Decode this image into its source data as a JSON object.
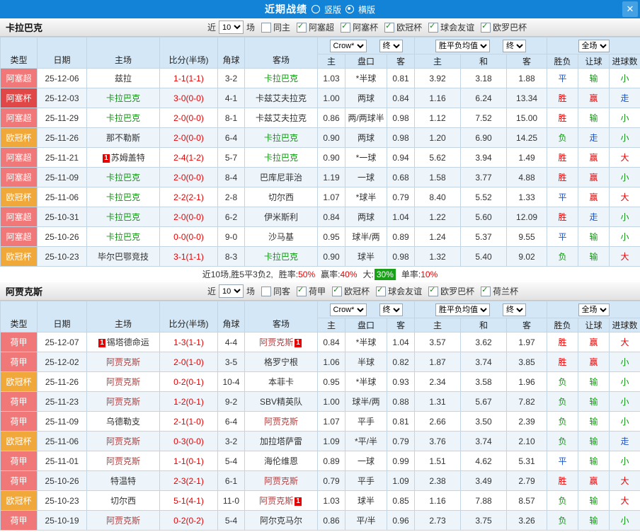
{
  "topbar": {
    "title": "近期战绩",
    "vertical_label": "竖版",
    "horizontal_label": "横版",
    "selected_layout": "横版",
    "close_glyph": "✕",
    "bg": "#1283d6"
  },
  "filter_words": {
    "near": "近",
    "matches": "场"
  },
  "table_head": {
    "fixed_columns": [
      "类型",
      "日期",
      "主场",
      "比分(半场)",
      "角球",
      "客场"
    ],
    "sub_columns": [
      "主",
      "盘口",
      "客",
      "主",
      "和",
      "客",
      "胜负",
      "让球",
      "进球数"
    ],
    "selects": {
      "bookmaker": "Crow*",
      "final": "终",
      "europe_mean": "胜平负均值",
      "scope": "全场"
    }
  },
  "colors": {
    "type_bg": {
      "阿塞超": "#f07878",
      "阿塞杯": "#e04848",
      "欧冠杯": "#f0a83a",
      "荷甲": "#f07878",
      "荷兰杯": "#d8a800"
    },
    "result": {
      "胜": "#e60000",
      "平": "#2053c8",
      "负": "#0c9a0c",
      "赢": "#e60000",
      "走": "#2053c8",
      "输": "#0c9a0c",
      "大": "#e60000",
      "小": "#0c9a0c"
    },
    "score": "#e60000",
    "badge_bg": "#e60000"
  },
  "sections": [
    {
      "team": "卡拉巴克",
      "subject_color": "#0c9a0c",
      "filters": {
        "count": "10",
        "same_label": "同主",
        "same_checked": false,
        "leagues": [
          "阿塞超",
          "阿塞杯",
          "欧冠杯",
          "球会友谊",
          "欧罗巴杯"
        ]
      },
      "rows": [
        {
          "type": "阿塞超",
          "date": "25-12-06",
          "home": "兹拉",
          "score": "1-1(1-1)",
          "corner": "3-2",
          "away": "卡拉巴克",
          "away_subject": true,
          "asia": [
            "1.03",
            "*半球",
            "0.81"
          ],
          "europe": [
            "3.92",
            "3.18",
            "1.88"
          ],
          "results": [
            "平",
            "输",
            "小"
          ]
        },
        {
          "type": "阿塞杯",
          "date": "25-12-03",
          "home": "卡拉巴克",
          "home_subject": true,
          "score": "3-0(0-0)",
          "corner": "4-1",
          "away": "卡兹艾夫拉克",
          "asia": [
            "1.00",
            "两球",
            "0.84"
          ],
          "europe": [
            "1.16",
            "6.24",
            "13.34"
          ],
          "results": [
            "胜",
            "赢",
            "走"
          ]
        },
        {
          "type": "阿塞超",
          "date": "25-11-29",
          "home": "卡拉巴克",
          "home_subject": true,
          "score": "2-0(0-0)",
          "corner": "8-1",
          "away": "卡兹艾夫拉克",
          "asia": [
            "0.86",
            "两/两球半",
            "0.98"
          ],
          "europe": [
            "1.12",
            "7.52",
            "15.00"
          ],
          "results": [
            "胜",
            "输",
            "小"
          ]
        },
        {
          "type": "欧冠杯",
          "date": "25-11-26",
          "home": "那不勒斯",
          "score": "2-0(0-0)",
          "corner": "6-4",
          "away": "卡拉巴克",
          "away_subject": true,
          "asia": [
            "0.90",
            "两球",
            "0.98"
          ],
          "europe": [
            "1.20",
            "6.90",
            "14.25"
          ],
          "results": [
            "负",
            "走",
            "小"
          ]
        },
        {
          "type": "阿塞超",
          "date": "25-11-21",
          "home": "苏姆盖特",
          "home_badge": "1",
          "score": "2-4(1-2)",
          "corner": "5-7",
          "away": "卡拉巴克",
          "away_subject": true,
          "asia": [
            "0.90",
            "*一球",
            "0.94"
          ],
          "europe": [
            "5.62",
            "3.94",
            "1.49"
          ],
          "results": [
            "胜",
            "赢",
            "大"
          ]
        },
        {
          "type": "阿塞超",
          "date": "25-11-09",
          "home": "卡拉巴克",
          "home_subject": true,
          "score": "2-0(0-0)",
          "corner": "8-4",
          "away": "巴库尼菲治",
          "asia": [
            "1.19",
            "一球",
            "0.68"
          ],
          "europe": [
            "1.58",
            "3.77",
            "4.88"
          ],
          "results": [
            "胜",
            "赢",
            "小"
          ]
        },
        {
          "type": "欧冠杯",
          "date": "25-11-06",
          "home": "卡拉巴克",
          "home_subject": true,
          "score": "2-2(2-1)",
          "corner": "2-8",
          "away": "切尔西",
          "asia": [
            "1.07",
            "*球半",
            "0.79"
          ],
          "europe": [
            "8.40",
            "5.52",
            "1.33"
          ],
          "results": [
            "平",
            "赢",
            "大"
          ]
        },
        {
          "type": "阿塞超",
          "date": "25-10-31",
          "home": "卡拉巴克",
          "home_subject": true,
          "score": "2-0(0-0)",
          "corner": "6-2",
          "away": "伊米斯利",
          "asia": [
            "0.84",
            "两球",
            "1.04"
          ],
          "europe": [
            "1.22",
            "5.60",
            "12.09"
          ],
          "results": [
            "胜",
            "走",
            "小"
          ]
        },
        {
          "type": "阿塞超",
          "date": "25-10-26",
          "home": "卡拉巴克",
          "home_subject": true,
          "score": "0-0(0-0)",
          "corner": "9-0",
          "away": "沙马基",
          "asia": [
            "0.95",
            "球半/两",
            "0.89"
          ],
          "europe": [
            "1.24",
            "5.37",
            "9.55"
          ],
          "results": [
            "平",
            "输",
            "小"
          ]
        },
        {
          "type": "欧冠杯",
          "date": "25-10-23",
          "home": "毕尔巴鄂竞技",
          "score": "3-1(1-1)",
          "corner": "8-3",
          "away": "卡拉巴克",
          "away_subject": true,
          "asia": [
            "0.90",
            "球半",
            "0.98"
          ],
          "europe": [
            "1.32",
            "5.40",
            "9.02"
          ],
          "results": [
            "负",
            "输",
            "大"
          ]
        }
      ],
      "summary": {
        "prefix": "近10场,胜5平3负2,",
        "items": [
          {
            "label": "胜率:",
            "value": "50%",
            "style": "red"
          },
          {
            "label": "赢率:",
            "value": "40%",
            "style": "red"
          },
          {
            "label": "大:",
            "value": "30%",
            "style": "green-badge"
          },
          {
            "label": "单率:",
            "value": "10%",
            "style": "red"
          }
        ]
      }
    },
    {
      "team": "阿贾克斯",
      "subject_color": "#b04040",
      "filters": {
        "count": "10",
        "same_label": "同客",
        "same_checked": false,
        "leagues": [
          "荷甲",
          "欧冠杯",
          "球会友谊",
          "欧罗巴杯",
          "荷兰杯"
        ]
      },
      "rows": [
        {
          "type": "荷甲",
          "date": "25-12-07",
          "home": "锡塔德命运",
          "home_badge": "1",
          "score": "1-3(1-1)",
          "corner": "4-4",
          "away": "阿贾克斯",
          "away_subject": true,
          "away_badge": "1",
          "asia": [
            "0.84",
            "*半球",
            "1.04"
          ],
          "europe": [
            "3.57",
            "3.62",
            "1.97"
          ],
          "results": [
            "胜",
            "赢",
            "大"
          ]
        },
        {
          "type": "荷甲",
          "date": "25-12-02",
          "home": "阿贾克斯",
          "home_subject": true,
          "score": "2-0(1-0)",
          "corner": "3-5",
          "away": "格罗宁根",
          "asia": [
            "1.06",
            "半球",
            "0.82"
          ],
          "europe": [
            "1.87",
            "3.74",
            "3.85"
          ],
          "results": [
            "胜",
            "赢",
            "小"
          ]
        },
        {
          "type": "欧冠杯",
          "date": "25-11-26",
          "home": "阿贾克斯",
          "home_subject": true,
          "score": "0-2(0-1)",
          "corner": "10-4",
          "away": "本菲卡",
          "asia": [
            "0.95",
            "*半球",
            "0.93"
          ],
          "europe": [
            "2.34",
            "3.58",
            "1.96"
          ],
          "results": [
            "负",
            "输",
            "小"
          ]
        },
        {
          "type": "荷甲",
          "date": "25-11-23",
          "home": "阿贾克斯",
          "home_subject": true,
          "score": "1-2(0-1)",
          "corner": "9-2",
          "away": "SBV精英队",
          "asia": [
            "1.00",
            "球半/两",
            "0.88"
          ],
          "europe": [
            "1.31",
            "5.67",
            "7.82"
          ],
          "results": [
            "负",
            "输",
            "小"
          ]
        },
        {
          "type": "荷甲",
          "date": "25-11-09",
          "home": "乌德勒支",
          "score": "2-1(1-0)",
          "corner": "6-4",
          "away": "阿贾克斯",
          "away_subject": true,
          "asia": [
            "1.07",
            "平手",
            "0.81"
          ],
          "europe": [
            "2.66",
            "3.50",
            "2.39"
          ],
          "results": [
            "负",
            "输",
            "小"
          ]
        },
        {
          "type": "欧冠杯",
          "date": "25-11-06",
          "home": "阿贾克斯",
          "home_subject": true,
          "score": "0-3(0-0)",
          "corner": "3-2",
          "away": "加拉塔萨雷",
          "asia": [
            "1.09",
            "*平/半",
            "0.79"
          ],
          "europe": [
            "3.76",
            "3.74",
            "2.10"
          ],
          "results": [
            "负",
            "输",
            "走"
          ]
        },
        {
          "type": "荷甲",
          "date": "25-11-01",
          "home": "阿贾克斯",
          "home_subject": true,
          "score": "1-1(0-1)",
          "corner": "5-4",
          "away": "海伦维恩",
          "asia": [
            "0.89",
            "一球",
            "0.99"
          ],
          "europe": [
            "1.51",
            "4.62",
            "5.31"
          ],
          "results": [
            "平",
            "输",
            "小"
          ]
        },
        {
          "type": "荷甲",
          "date": "25-10-26",
          "home": "特温特",
          "score": "2-3(2-1)",
          "corner": "6-1",
          "away": "阿贾克斯",
          "away_subject": true,
          "asia": [
            "0.79",
            "平手",
            "1.09"
          ],
          "europe": [
            "2.38",
            "3.49",
            "2.79"
          ],
          "results": [
            "胜",
            "赢",
            "大"
          ]
        },
        {
          "type": "欧冠杯",
          "date": "25-10-23",
          "home": "切尔西",
          "score": "5-1(4-1)",
          "corner": "11-0",
          "away": "阿贾克斯",
          "away_subject": true,
          "away_badge": "1",
          "asia": [
            "1.03",
            "球半",
            "0.85"
          ],
          "europe": [
            "1.16",
            "7.88",
            "8.57"
          ],
          "results": [
            "负",
            "输",
            "大"
          ]
        },
        {
          "type": "荷甲",
          "date": "25-10-19",
          "home": "阿贾克斯",
          "home_subject": true,
          "score": "0-2(0-2)",
          "corner": "5-4",
          "away": "阿尔克马尔",
          "asia": [
            "0.86",
            "平/半",
            "0.96"
          ],
          "europe": [
            "2.73",
            "3.75",
            "3.26"
          ],
          "results": [
            "负",
            "输",
            "小"
          ]
        }
      ]
    }
  ]
}
